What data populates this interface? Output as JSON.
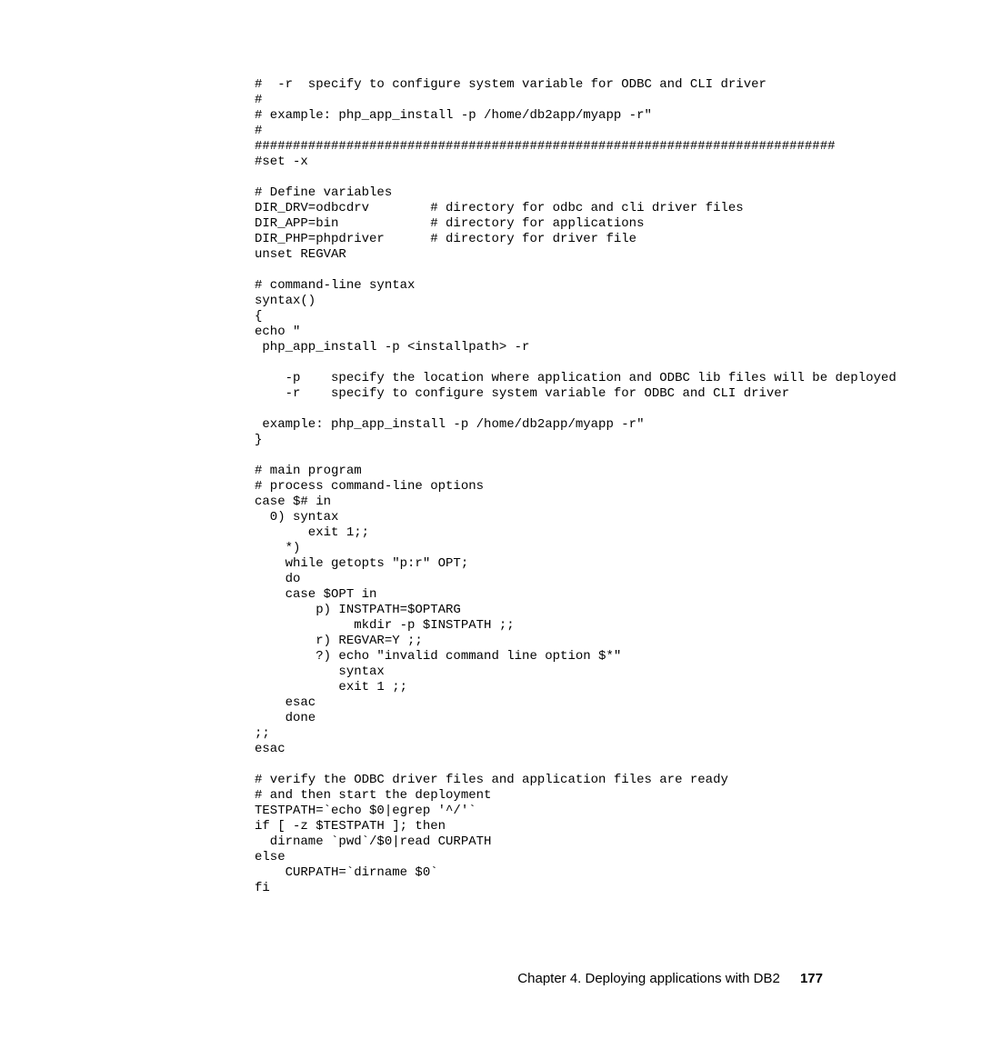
{
  "code": "#  -r  specify to configure system variable for ODBC and CLI driver\n#\n# example: php_app_install -p /home/db2app/myapp -r\"\n#\n############################################################################\n#set -x\n\n# Define variables\nDIR_DRV=odbcdrv        # directory for odbc and cli driver files\nDIR_APP=bin            # directory for applications\nDIR_PHP=phpdriver      # directory for driver file\nunset REGVAR\n\n# command-line syntax\nsyntax()\n{\necho \"\n php_app_install -p <installpath> -r\n\n    -p    specify the location where application and ODBC lib files will be deployed\n    -r    specify to configure system variable for ODBC and CLI driver\n\n example: php_app_install -p /home/db2app/myapp -r\"\n}\n\n# main program\n# process command-line options\ncase $# in\n  0) syntax\n       exit 1;;\n    *)\n    while getopts \"p:r\" OPT;\n    do\n    case $OPT in\n        p) INSTPATH=$OPTARG\n             mkdir -p $INSTPATH ;;\n        r) REGVAR=Y ;;\n        ?) echo \"invalid command line option $*\"\n           syntax\n           exit 1 ;;\n    esac\n    done\n;;\nesac\n\n# verify the ODBC driver files and application files are ready\n# and then start the deployment\nTESTPATH=`echo $0|egrep '^/'`\nif [ -z $TESTPATH ]; then\n  dirname `pwd`/$0|read CURPATH\nelse\n    CURPATH=`dirname $0`\nfi",
  "footer": {
    "chapter": "Chapter 4. Deploying applications with DB2",
    "pagenum": "177"
  }
}
